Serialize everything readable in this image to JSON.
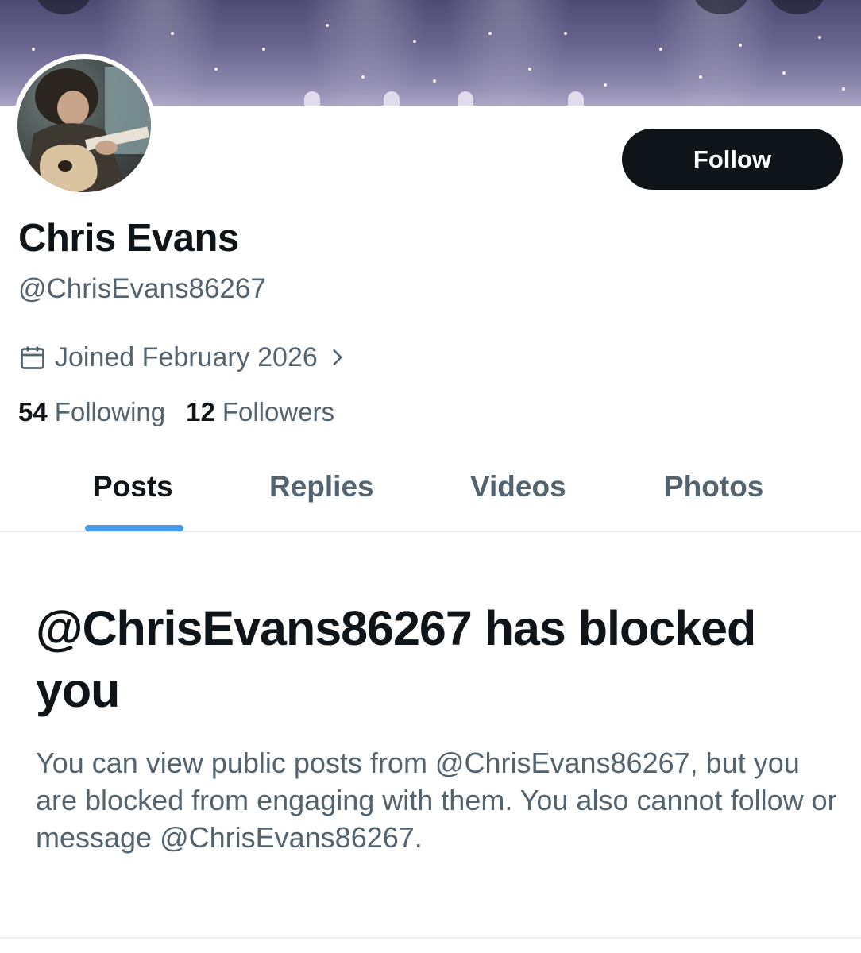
{
  "profile": {
    "display_name": "Chris Evans",
    "handle": "@ChrisEvans86267",
    "joined": "Joined February 2026",
    "following_count": "54",
    "following_label": "Following",
    "followers_count": "12",
    "followers_label": "Followers",
    "follow_label": "Follow"
  },
  "tabs": [
    {
      "label": "Posts",
      "active": true
    },
    {
      "label": "Replies",
      "active": false
    },
    {
      "label": "Videos",
      "active": false
    },
    {
      "label": "Photos",
      "active": false
    }
  ],
  "blocked": {
    "title": "@ChrisEvans86267 has blocked you",
    "body": "You can view public posts from @ChrisEvans86267, but you are blocked from engaging with them. You also cannot follow or message @ChrisEvans86267."
  },
  "icons": {
    "joined": "calendar-icon",
    "joined_more": "chevron-right-icon"
  },
  "colors": {
    "text_primary": "#0f1419",
    "text_secondary": "#536471",
    "tab_indicator": "#4b9bed",
    "follow_bg": "#0f1419"
  }
}
